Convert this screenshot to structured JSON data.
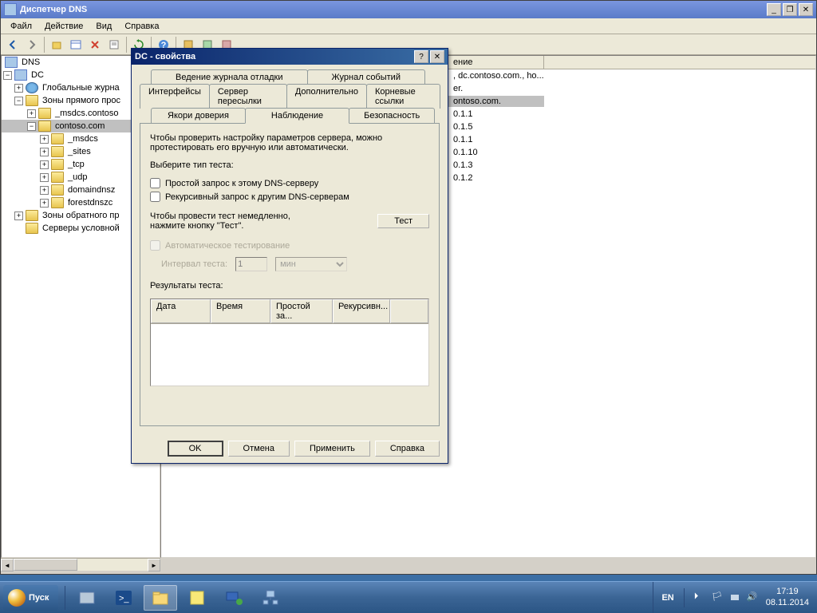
{
  "window": {
    "title": "Диспетчер DNS"
  },
  "menu": {
    "file": "Файл",
    "action": "Действие",
    "view": "Вид",
    "help": "Справка"
  },
  "tree": {
    "root": "DNS",
    "dc": "DC",
    "global_logs": "Глобальные журна",
    "forward_zones": "Зоны прямого прос",
    "msdcs_contoso": "_msdcs.contoso",
    "contoso": "contoso.com",
    "msdcs": "_msdcs",
    "sites": "_sites",
    "tcp": "_tcp",
    "udp": "_udp",
    "domaindns": "domaindnsz",
    "forestdns": "forestdnszc",
    "reverse_zones": "Зоны обратного пр",
    "conditional": "Серверы условной"
  },
  "list": {
    "col_desc": "ение",
    "r1": ", dc.contoso.com., ho...",
    "r2": "er.",
    "r3": "ontoso.com.",
    "r4": "0.1.1",
    "r5": "0.1.5",
    "r6": "0.1.1",
    "r7": "0.1.10",
    "r8": "0.1.3",
    "r9": "0.1.2"
  },
  "dialog": {
    "title": "DC - свойства",
    "tabs": {
      "debug_log": "Ведение журнала отладки",
      "event_log": "Журнал событий",
      "interfaces": "Интерфейсы",
      "forwarders": "Сервер пересылки",
      "advanced": "Дополнительно",
      "root_hints": "Корневые ссылки",
      "trust_anchors": "Якори доверия",
      "monitoring": "Наблюдение",
      "security": "Безопасность"
    },
    "desc1": "Чтобы проверить настройку параметров сервера, можно протестировать его вручную или автоматически.",
    "choose_test": "Выберите тип теста:",
    "simple_query": "Простой запрос к этому DNS-серверу",
    "recursive_query": "Рекурсивный запрос к другим DNS-серверам",
    "run_test_desc": "Чтобы провести тест немедленно, нажмите кнопку \"Тест\".",
    "test_btn": "Тест",
    "auto_test": "Автоматическое тестирование",
    "interval_label": "Интервал теста:",
    "interval_value": "1",
    "interval_unit": "мин",
    "results_label": "Результаты теста:",
    "col_date": "Дата",
    "col_time": "Время",
    "col_simple": "Простой за...",
    "col_recursive": "Рекурсивн...",
    "ok": "OK",
    "cancel": "Отмена",
    "apply": "Применить",
    "help": "Справка"
  },
  "taskbar": {
    "start": "Пуск",
    "lang": "EN",
    "time": "17:19",
    "date": "08.11.2014"
  }
}
